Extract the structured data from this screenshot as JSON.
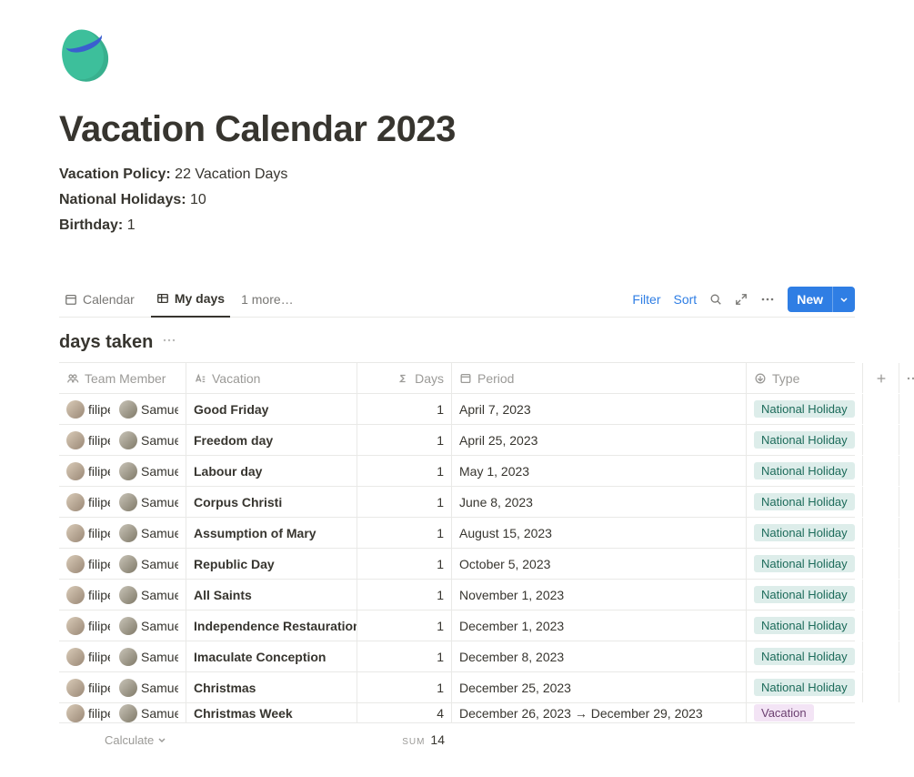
{
  "page": {
    "title": "Vacation Calendar 2023",
    "policy_label": "Vacation Policy:",
    "policy_value": "22 Vacation Days",
    "holidays_label": "National Holidays:",
    "holidays_value": "10",
    "birthday_label": "Birthday:",
    "birthday_value": "1"
  },
  "views": {
    "calendar": "Calendar",
    "mydays": "My days",
    "more": "1 more…"
  },
  "toolbar": {
    "filter": "Filter",
    "sort": "Sort",
    "new": "New"
  },
  "group": {
    "title": "days taken"
  },
  "columns": {
    "team": "Team Member",
    "vacation": "Vacation",
    "days": "Days",
    "period": "Period",
    "type": "Type"
  },
  "members": {
    "a": "filipe",
    "b": "Samuel"
  },
  "rows": [
    {
      "vacation": "Good Friday",
      "days": "1",
      "period": "April 7, 2023",
      "type": "National Holiday"
    },
    {
      "vacation": "Freedom day",
      "days": "1",
      "period": "April 25, 2023",
      "type": "National Holiday"
    },
    {
      "vacation": "Labour day",
      "days": "1",
      "period": "May 1, 2023",
      "type": "National Holiday"
    },
    {
      "vacation": "Corpus Christi",
      "days": "1",
      "period": "June 8, 2023",
      "type": "National Holiday"
    },
    {
      "vacation": "Assumption of Mary",
      "days": "1",
      "period": "August 15, 2023",
      "type": "National Holiday"
    },
    {
      "vacation": "Republic Day",
      "days": "1",
      "period": "October 5, 2023",
      "type": "National Holiday"
    },
    {
      "vacation": "All Saints",
      "days": "1",
      "period": "November 1, 2023",
      "type": "National Holiday"
    },
    {
      "vacation": "Independence Restauration",
      "days": "1",
      "period": "December 1, 2023",
      "type": "National Holiday"
    },
    {
      "vacation": "Imaculate Conception",
      "days": "1",
      "period": "December 8, 2023",
      "type": "National Holiday"
    },
    {
      "vacation": "Christmas",
      "days": "1",
      "period": "December 25, 2023",
      "type": "National Holiday"
    }
  ],
  "partial_row": {
    "vacation": "Christmas Week",
    "days": "4",
    "period": "December 26, 2023 → December 29, 2023",
    "type": "Vacation"
  },
  "footer": {
    "calculate": "Calculate",
    "sum_label": "SUM",
    "sum_value": "14"
  }
}
